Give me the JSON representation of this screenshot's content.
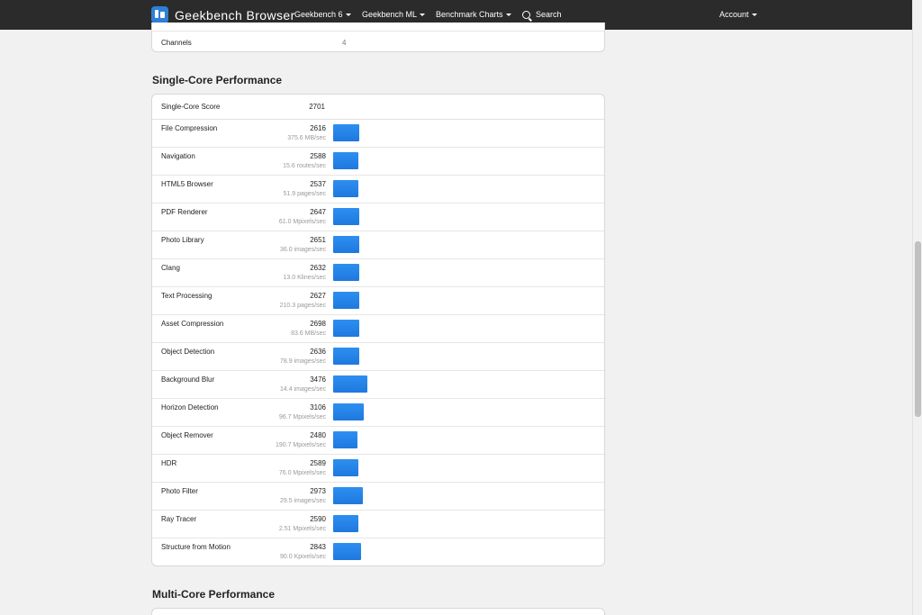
{
  "nav": {
    "brand": "Geekbench Browser",
    "items": [
      "Geekbench 6",
      "Geekbench ML",
      "Benchmark Charts"
    ],
    "search": "Search",
    "account": "Account"
  },
  "system": {
    "channels_label": "Channels",
    "channels_value": "4"
  },
  "single_core": {
    "title": "Single-Core Performance",
    "score_label": "Single-Core Score",
    "score": "2701",
    "max_bar_score": 3476,
    "benchmarks": [
      {
        "name": "File Compression",
        "score": 2616,
        "rate": "375.6 MB/sec"
      },
      {
        "name": "Navigation",
        "score": 2588,
        "rate": "15.6 routes/sec"
      },
      {
        "name": "HTML5 Browser",
        "score": 2537,
        "rate": "51.9 pages/sec"
      },
      {
        "name": "PDF Renderer",
        "score": 2647,
        "rate": "61.0 Mpixels/sec"
      },
      {
        "name": "Photo Library",
        "score": 2651,
        "rate": "36.0 images/sec"
      },
      {
        "name": "Clang",
        "score": 2632,
        "rate": "13.0 Klines/sec"
      },
      {
        "name": "Text Processing",
        "score": 2627,
        "rate": "210.3 pages/sec"
      },
      {
        "name": "Asset Compression",
        "score": 2698,
        "rate": "83.6 MB/sec"
      },
      {
        "name": "Object Detection",
        "score": 2636,
        "rate": "78.9 images/sec"
      },
      {
        "name": "Background Blur",
        "score": 3476,
        "rate": "14.4 images/sec"
      },
      {
        "name": "Horizon Detection",
        "score": 3106,
        "rate": "96.7 Mpixels/sec"
      },
      {
        "name": "Object Remover",
        "score": 2480,
        "rate": "190.7 Mpixels/sec"
      },
      {
        "name": "HDR",
        "score": 2589,
        "rate": "76.0 Mpixels/sec"
      },
      {
        "name": "Photo Filter",
        "score": 2973,
        "rate": "29.5 images/sec"
      },
      {
        "name": "Ray Tracer",
        "score": 2590,
        "rate": "2.51 Mpixels/sec"
      },
      {
        "name": "Structure from Motion",
        "score": 2843,
        "rate": "90.0 Kpixels/sec"
      }
    ]
  },
  "multi_core": {
    "title": "Multi-Core Performance"
  },
  "colors": {
    "navbar": "#2b2b2b",
    "bar": "#1f78de",
    "background": "#f1f1f1"
  }
}
